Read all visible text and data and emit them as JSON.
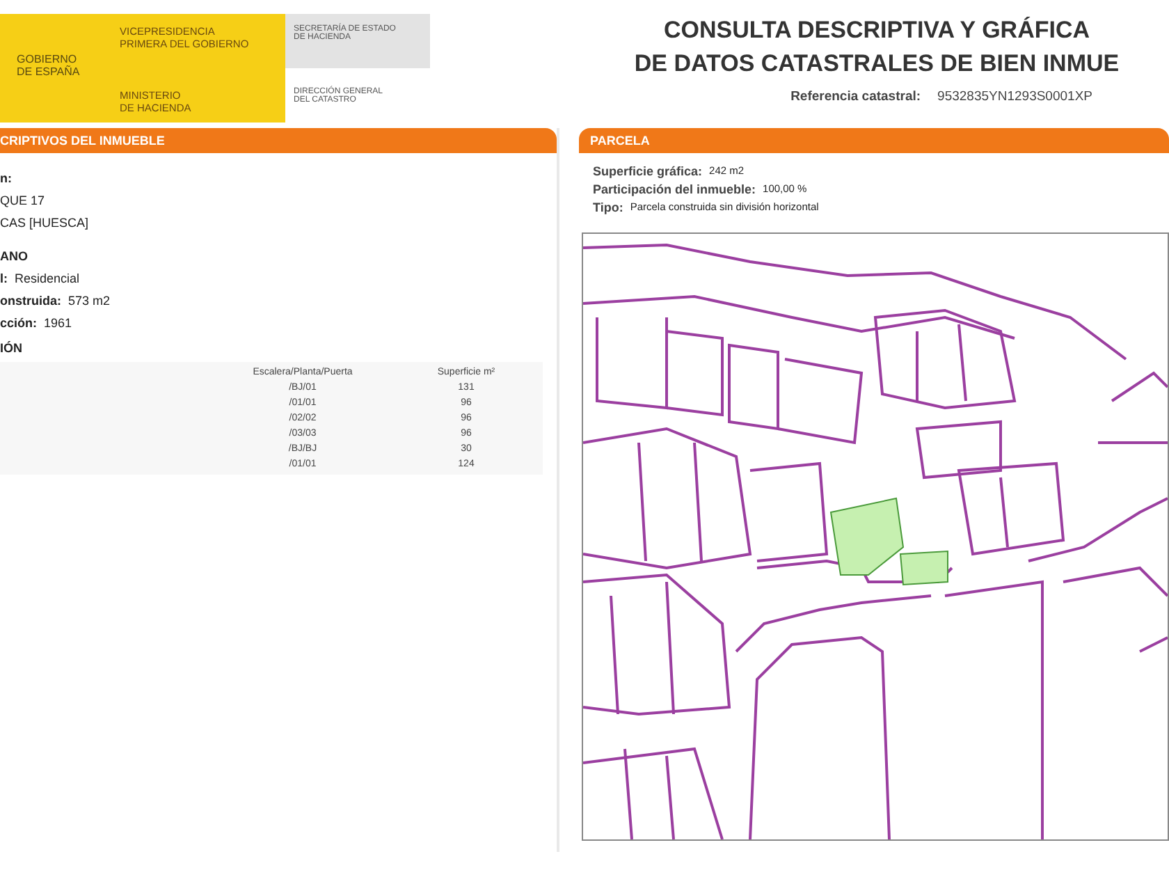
{
  "header": {
    "logo": {
      "country": "GOBIERNO\nDE ESPAÑA",
      "vice": "VICEPRESIDENCIA\nPRIMERA DEL GOBIERNO",
      "ministry": "MINISTERIO\nDE HACIENDA",
      "secretary": "SECRETARÍA DE ESTADO\nDE HACIENDA",
      "directorate": "DIRECCIÓN GENERAL\nDEL CATASTRO"
    },
    "title": "CONSULTA DESCRIPTIVA Y GRÁFICA\nDE DATOS CATASTRALES DE BIEN INMUE",
    "reference_label": "Referencia catastral:",
    "reference_value": "9532835YN1293S0001XP"
  },
  "left_panel": {
    "heading": "CRIPTIVOS DEL INMUEBLE",
    "lines": [
      {
        "label": "n:"
      },
      {
        "value": "QUE 17"
      },
      {
        "value": "CAS [HUESCA]"
      },
      {
        "label": "ANO"
      },
      {
        "label": "l:",
        "value": "Residencial"
      },
      {
        "label": "onstruida:",
        "value": "573 m2"
      },
      {
        "label": "cción:",
        "value": "1961"
      }
    ],
    "section": "IÓN",
    "table": {
      "columns": [
        "Escalera/Planta/Puerta",
        "Superficie m²"
      ],
      "rows": [
        [
          "/BJ/01",
          "131"
        ],
        [
          "/01/01",
          "96"
        ],
        [
          "/02/02",
          "96"
        ],
        [
          "/03/03",
          "96"
        ],
        [
          "/BJ/BJ",
          "30"
        ],
        [
          "/01/01",
          "124"
        ]
      ]
    }
  },
  "right_panel": {
    "heading": "PARCELA",
    "fields": [
      {
        "label": "Superficie gráfica:",
        "value": "242 m2"
      },
      {
        "label": "Participación del inmueble:",
        "value": "100,00 %"
      },
      {
        "label": "Tipo:",
        "value": "Parcela construida sin división horizontal"
      }
    ]
  }
}
